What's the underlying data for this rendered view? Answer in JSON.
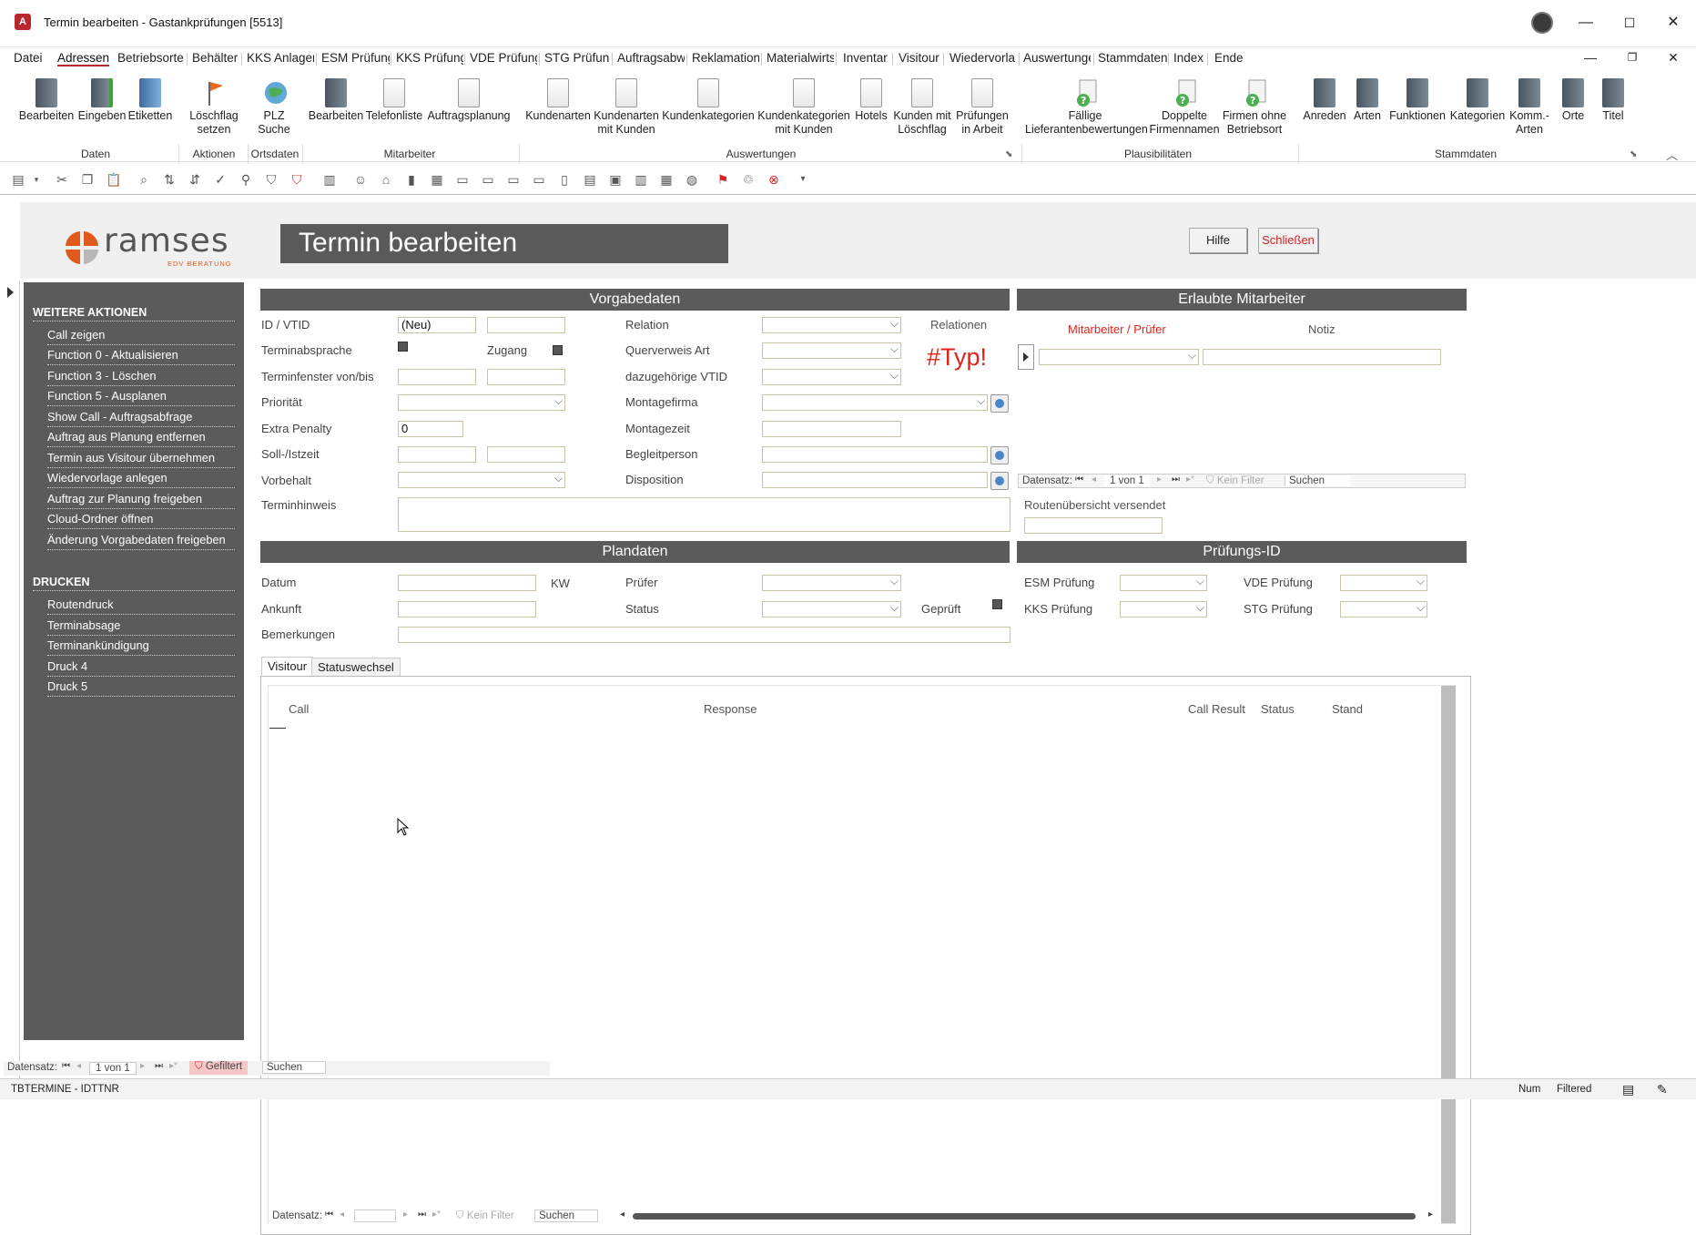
{
  "window": {
    "app_icon": "A",
    "title": "Termin bearbeiten  -  Gastankprüfungen [5513]"
  },
  "menu": [
    "Datei",
    "Adressen",
    "Betriebsorte",
    "Behälter",
    "KKS Anlager",
    "ESM Prüfung",
    "KKS Prüfung",
    "VDE Prüfung",
    "STG Prüfung",
    "Auftragsabw",
    "Reklamation",
    "Materialwirts",
    "Inventar",
    "Visitour",
    "Wiedervorla",
    "Auswertunge",
    "Stammdaten",
    "Index",
    "Ende"
  ],
  "ribbon": {
    "buttons": {
      "bearbeiten": "Bearbeiten",
      "eingeben": "Eingeben",
      "etiketten": "Etiketten",
      "loeschflag_setzen": "Löschflag setzen",
      "plz_suche": "PLZ Suche",
      "mitarbeiter_bearbeiten": "Bearbeiten",
      "telefonliste": "Telefonliste",
      "auftragsplanung": "Auftragsplanung",
      "kundenarten": "Kundenarten",
      "kundenarten_mit_kunden": "Kundenarten mit Kunden",
      "kundenkategorien": "Kundenkategorien",
      "kundenkategorien_mit_kunden": "Kundenkategorien mit Kunden",
      "hotels": "Hotels",
      "kunden_mit_loeschflag": "Kunden mit Löschflag",
      "pruefungen_in_arbeit": "Prüfungen in Arbeit",
      "faellige_lieferantenbewertungen": "Fällige Lieferantenbewertungen",
      "doppelte_firmennamen": "Doppelte Firmennamen",
      "firmen_ohne_betriebsort": "Firmen ohne Betriebsort",
      "anreden": "Anreden",
      "arten": "Arten",
      "funktionen": "Funktionen",
      "kategorien": "Kategorien",
      "komm_arten": "Komm.- Arten",
      "orte": "Orte",
      "titel": "Titel"
    },
    "groups": {
      "daten": "Daten",
      "aktionen": "Aktionen",
      "ortsdaten": "Ortsdaten",
      "mitarbeiter": "Mitarbeiter",
      "auswertungen": "Auswertungen",
      "plausibilitaeten": "Plausibilitäten",
      "stammdaten": "Stammdaten"
    }
  },
  "header": {
    "logo_main": "ramses",
    "logo_sub": "EDV BERATUNG",
    "title": "Termin bearbeiten",
    "help_button": "Hilfe",
    "close_button": "Schließen"
  },
  "sidebar": {
    "section1_title": "WEITERE AKTIONEN",
    "section1_items": [
      "Call zeigen",
      "Function 0 - Aktualisieren",
      "Function 3 - Löschen",
      "Function 5 - Ausplanen",
      "Show Call - Auftragsabfrage",
      "Auftrag aus Planung entfernen",
      "Termin aus Visitour übernehmen",
      "Wiedervorlage anlegen",
      "Auftrag zur Planung freigeben",
      "Cloud-Ordner öffnen",
      "Änderung Vorgabedaten freigeben"
    ],
    "section2_title": "DRUCKEN",
    "section2_items": [
      "Routendruck",
      "Terminabsage",
      "Terminankündigung",
      "Druck 4",
      "Druck 5"
    ]
  },
  "vorgabedaten": {
    "title": "Vorgabedaten",
    "labels": {
      "id_vtid": "ID / VTID",
      "terminabsprache": "Terminabsprache",
      "zugang": "Zugang",
      "terminfenster": "Terminfenster von/bis",
      "prioritaet": "Priorität",
      "extra_penalty": "Extra Penalty",
      "soll_istzeit": "Soll-/Istzeit",
      "vorbehalt": "Vorbehalt",
      "terminhinweis": "Terminhinweis",
      "relation": "Relation",
      "querverweis_art": "Querverweis Art",
      "dazugehoerige_vtid": "dazugehörige VTID",
      "montagefirma": "Montagefirma",
      "montagezeit": "Montagezeit",
      "begleitperson": "Begleitperson",
      "disposition": "Disposition",
      "relationen": "Relationen"
    },
    "values": {
      "id": "(Neu)",
      "extra_penalty": "0"
    },
    "typ_error": "#Typ!"
  },
  "erlaubte_mitarbeiter": {
    "title": "Erlaubte Mitarbeiter",
    "col_mitarbeiter": "Mitarbeiter / Prüfer",
    "col_notiz": "Notiz",
    "nav_label": "Datensatz:",
    "nav_record": "1 von 1",
    "nav_filter": "Kein Filter",
    "nav_search": "Suchen",
    "routen_label": "Routenübersicht versendet"
  },
  "plandaten": {
    "title": "Plandaten",
    "datum": "Datum",
    "kw": "KW",
    "ankunft": "Ankunft",
    "bemerkungen": "Bemerkungen",
    "pruefer": "Prüfer",
    "status": "Status",
    "geprueft": "Geprüft"
  },
  "pruefungs_id": {
    "title": "Prüfungs-ID",
    "esm": "ESM Prüfung",
    "kks": "KKS Prüfung",
    "vde": "VDE Prüfung",
    "stg": "STG Prüfung"
  },
  "tabs": [
    "Visitour",
    "Statuswechsel"
  ],
  "grid": {
    "columns": [
      "Call",
      "Response",
      "Call Result",
      "Status",
      "Stand"
    ],
    "nav_label": "Datensatz:",
    "nav_filter": "Kein Filter",
    "nav_search": "Suchen"
  },
  "form_nav": {
    "label": "Datensatz:",
    "record": "1 von 1",
    "filter": "Gefiltert",
    "search": "Suchen"
  },
  "statusbar": {
    "left": "TBTERMINE - IDTTNR",
    "num": "Num",
    "filtered": "Filtered"
  },
  "colors": {
    "accent": "#b7282e",
    "section": "#5b5b5b",
    "error": "#e0241c"
  }
}
